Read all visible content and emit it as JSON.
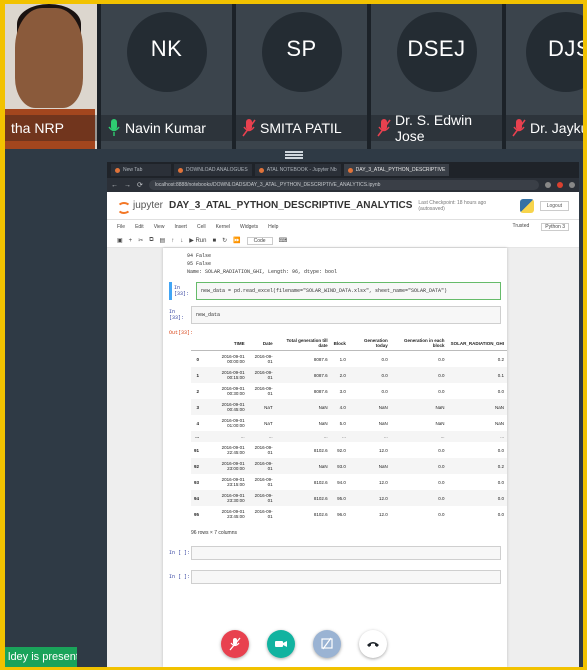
{
  "participants": [
    {
      "initials": "",
      "name": "tha NRP",
      "muted": false
    },
    {
      "initials": "NK",
      "name": "Navin Kumar",
      "muted": false
    },
    {
      "initials": "SP",
      "name": "SMITA PATIL",
      "muted": true
    },
    {
      "initials": "DSEJ",
      "name": "Dr. S. Edwin Jose",
      "muted": true
    },
    {
      "initials": "DJS",
      "name": "Dr. Jaykuma",
      "muted": true
    }
  ],
  "presenting_label": "ldey is presenting",
  "browser": {
    "tabs": [
      "New Tab",
      "DOWNLOAD ANALOGUES",
      "ATAL NOTEBOOK - Jupyter Nb",
      "DAY_3_ATAL_PYTHON_DESCRIPTIVE"
    ],
    "url": "localhost:8888/notebooks/DOWNLOADS/DAY_3_ATAL_PYTHON_DESCRIPTIVE_ANALYTICS.ipynb"
  },
  "jupyter": {
    "brand": "jupyter",
    "notebook_title": "DAY_3_ATAL_PYTHON_DESCRIPTIVE_ANALYTICS",
    "checkpoint": "Last Checkpoint: 18 hours ago (autosaved)",
    "logout": "Logout",
    "menu": [
      "File",
      "Edit",
      "View",
      "Insert",
      "Cell",
      "Kernel",
      "Widgets",
      "Help"
    ],
    "trusted": "Trusted",
    "kernel": "Python 3",
    "toolbar_run": "Run",
    "cell_type": "Code"
  },
  "output_lines": [
    "94    False",
    "95    False",
    "Name: SOLAR_RADIATION_GHI, Length: 96, dtype: bool"
  ],
  "cells": [
    {
      "prompt": "In [33]:",
      "code": "new_data = pd.read_excel(filename=\"SOLAR_WIND_DATA.xlsx\", sheet_name=\"SOLAR_DATA\")"
    },
    {
      "prompt": "In [33]:",
      "code": "new_data"
    }
  ],
  "out_prompt": "Out[33]:",
  "table": {
    "columns": [
      "",
      "TIME",
      "Date",
      "Total generation till date",
      "Block",
      "Generation today",
      "Generation in each block",
      "SOLAR_RADIATION_GHI"
    ],
    "rows": [
      [
        "0",
        "2016-09-01 00:00:00",
        "2016-09-01",
        "8087.6",
        "1.0",
        "0.0",
        "0.0",
        "0.2"
      ],
      [
        "1",
        "2016-09-01 00:15:00",
        "2016-09-01",
        "8087.6",
        "2.0",
        "0.0",
        "0.0",
        "0.1"
      ],
      [
        "2",
        "2016-09-01 00:30:00",
        "2016-09-01",
        "8087.6",
        "3.0",
        "0.0",
        "0.0",
        "0.0"
      ],
      [
        "3",
        "2016-09-01 00:45:00",
        "NaT",
        "NaN",
        "4.0",
        "NaN",
        "NaN",
        "NaN"
      ],
      [
        "4",
        "2016-09-01 01:00:00",
        "NaT",
        "NaN",
        "5.0",
        "NaN",
        "NaN",
        "NaN"
      ],
      [
        "...",
        "...",
        "...",
        "...",
        "...",
        "...",
        "...",
        "..."
      ],
      [
        "91",
        "2016-09-01 22:45:00",
        "2016-09-01",
        "8102.6",
        "92.0",
        "12.0",
        "0.0",
        "0.0"
      ],
      [
        "92",
        "2016-09-01 23:00:00",
        "2016-09-01",
        "NaN",
        "93.0",
        "NaN",
        "0.0",
        "0.2"
      ],
      [
        "93",
        "2016-09-01 23:15:00",
        "2016-09-01",
        "8102.6",
        "94.0",
        "12.0",
        "0.0",
        "0.0"
      ],
      [
        "94",
        "2016-09-01 23:30:00",
        "2016-09-01",
        "8102.6",
        "95.0",
        "12.0",
        "0.0",
        "0.0"
      ],
      [
        "95",
        "2016-09-01 23:45:00",
        "2016-09-01",
        "8102.6",
        "96.0",
        "12.0",
        "0.0",
        "0.0"
      ]
    ],
    "shape": "96 rows × 7 columns"
  },
  "empty_prompts": [
    "In [ ]:",
    "In [ ]:"
  ],
  "controls": [
    "mic-off",
    "camera",
    "share-screen",
    "leave"
  ],
  "colors": {
    "border": "#f2c200",
    "presenting": "#1aa35a",
    "mute": "#e8414f",
    "video": "#12b3a0"
  }
}
